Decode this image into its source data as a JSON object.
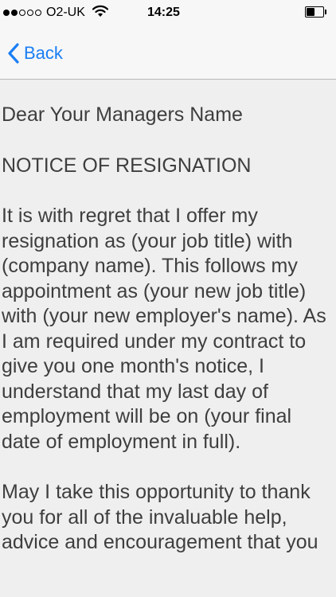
{
  "status_bar": {
    "signal_bars_filled": 2,
    "signal_bars_total": 5,
    "carrier": "O2-UK",
    "time": "14:25",
    "battery_level": 0.5,
    "wifi_icon": "wifi-icon"
  },
  "nav": {
    "back_label": "Back",
    "back_icon": "chevron-left-icon",
    "accent": "#1a7ef5"
  },
  "letter": {
    "salutation": "Dear Your Managers Name",
    "heading": "NOTICE OF RESIGNATION",
    "paragraph_1": "It is with regret that I offer my resignation as (your job title) with (company name). This follows my appointment as (your new job title) with (your new employer's name). As I am required under my contract to give you one month's notice, I understand that my last day of employment will be on (your final date of employment in full).",
    "paragraph_2": "May I take this opportunity to thank you for all of the invaluable help, advice and encouragement that you"
  }
}
